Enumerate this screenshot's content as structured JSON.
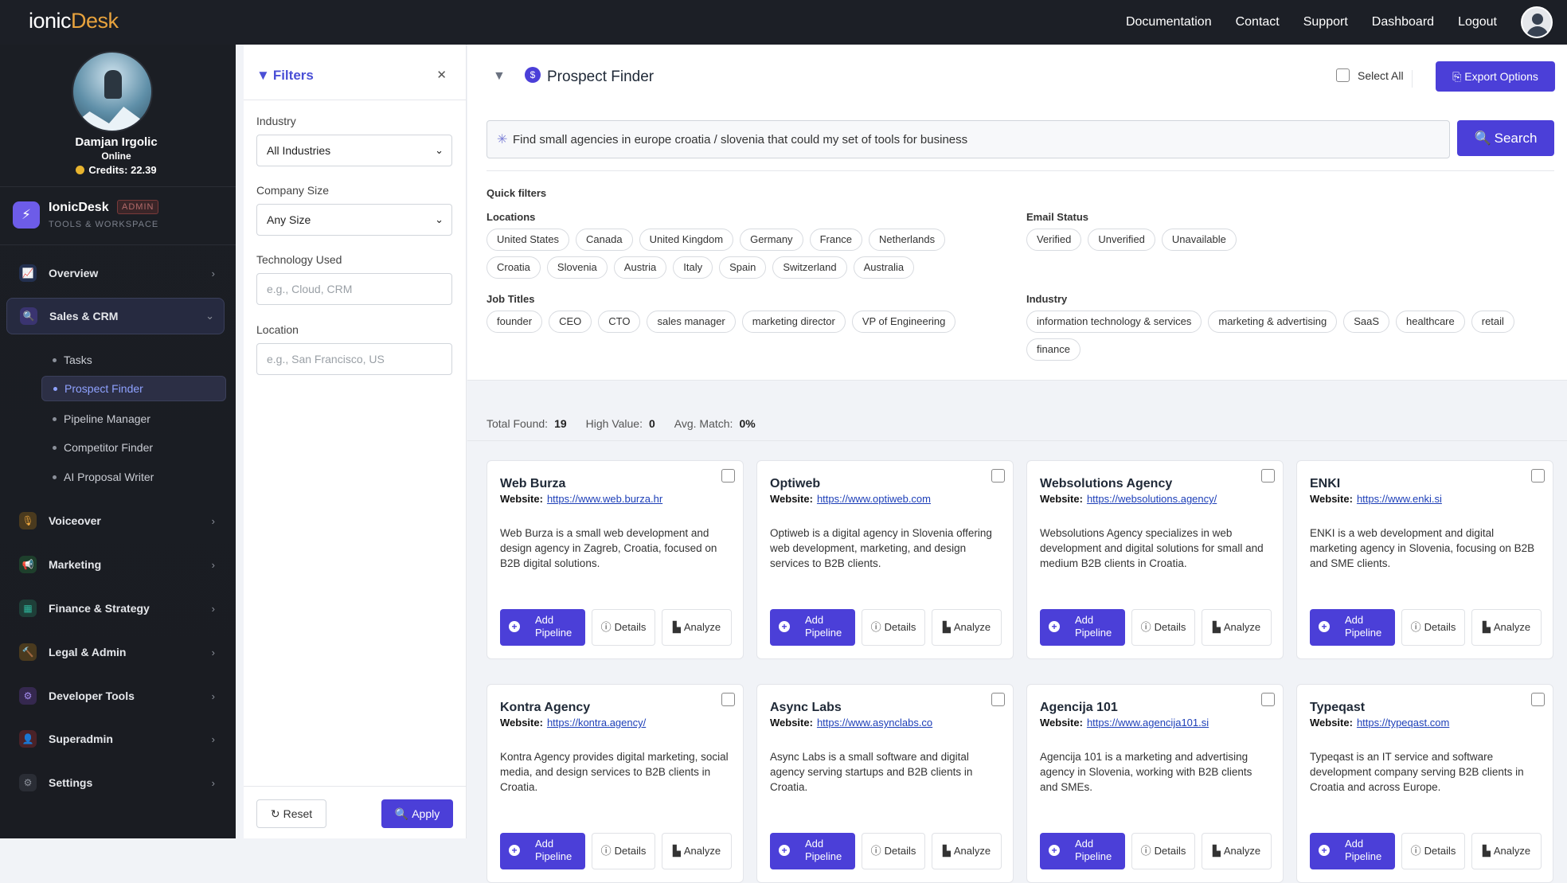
{
  "topbar": {
    "logo_a": "ionic",
    "logo_b": "Desk",
    "nav": [
      "Documentation",
      "Contact",
      "Support",
      "Dashboard",
      "Logout"
    ]
  },
  "profile": {
    "name": "Damjan Irgolic",
    "status": "Online",
    "credits": "Credits: 22.39"
  },
  "brand": {
    "name": "IonicDesk",
    "badge": "ADMIN",
    "subtitle": "TOOLS & WORKSPACE"
  },
  "sidebar": {
    "items": [
      {
        "label": "Overview",
        "icon": "chart-icon",
        "color": "#3b5bdb"
      },
      {
        "label": "Sales & CRM",
        "icon": "search-icon",
        "color": "#6d5ce8"
      },
      {
        "label": "Voiceover",
        "icon": "microphone-icon",
        "color": "#e8a33d"
      },
      {
        "label": "Marketing",
        "icon": "megaphone-icon",
        "color": "#2fb36a"
      },
      {
        "label": "Finance & Strategy",
        "icon": "calculator-icon",
        "color": "#2fb39a"
      },
      {
        "label": "Legal & Admin",
        "icon": "gavel-icon",
        "color": "#e8a33d"
      },
      {
        "label": "Developer Tools",
        "icon": "code-icon",
        "color": "#7b5be8"
      },
      {
        "label": "Superadmin",
        "icon": "user-shield-icon",
        "color": "#e05a6a"
      },
      {
        "label": "Settings",
        "icon": "gear-icon",
        "color": "#8b909a"
      }
    ],
    "sub_items": [
      "Tasks",
      "Prospect Finder",
      "Pipeline Manager",
      "Competitor Finder",
      "AI Proposal Writer"
    ]
  },
  "filters": {
    "title": "Filters",
    "industry_label": "Industry",
    "industry_value": "All Industries",
    "size_label": "Company Size",
    "size_value": "Any Size",
    "tech_label": "Technology Used",
    "tech_placeholder": "e.g., Cloud, CRM",
    "location_label": "Location",
    "location_placeholder": "e.g., San Francisco, US",
    "reset": "Reset",
    "apply": "Apply"
  },
  "header": {
    "title": "Prospect Finder",
    "select_all": "Select All",
    "export": "Export Options"
  },
  "search": {
    "query": "Find small agencies in europe croatia / slovenia that could my set of tools for business",
    "button": "Search"
  },
  "quick_filters": {
    "title": "Quick filters",
    "locations_label": "Locations",
    "locations": [
      "United States",
      "Canada",
      "United Kingdom",
      "Germany",
      "France",
      "Netherlands",
      "Croatia",
      "Slovenia",
      "Austria",
      "Italy",
      "Spain",
      "Switzerland",
      "Australia"
    ],
    "email_label": "Email Status",
    "email": [
      "Verified",
      "Unverified",
      "Unavailable"
    ],
    "jobs_label": "Job Titles",
    "jobs": [
      "founder",
      "CEO",
      "CTO",
      "sales manager",
      "marketing director",
      "VP of Engineering"
    ],
    "industry_label": "Industry",
    "industry": [
      "information technology & services",
      "marketing & advertising",
      "SaaS",
      "healthcare",
      "retail",
      "finance"
    ]
  },
  "stats": {
    "total_label": "Total Found:",
    "total": "19",
    "high_label": "High Value:",
    "high": "0",
    "avg_label": "Avg. Match:",
    "avg": "0%"
  },
  "card_labels": {
    "website": "Website:",
    "add": "Add Pipeline",
    "details": "Details",
    "analyze": "Analyze"
  },
  "results": [
    {
      "name": "Web Burza",
      "url": "https://www.web.burza.hr",
      "desc": "Web Burza is a small web development and design agency in Zagreb, Croatia, focused on B2B digital solutions."
    },
    {
      "name": "Optiweb",
      "url": "https://www.optiweb.com",
      "desc": "Optiweb is a digital agency in Slovenia offering web development, marketing, and design services to B2B clients."
    },
    {
      "name": "Websolutions Agency",
      "url": "https://websolutions.agency/",
      "desc": "Websolutions Agency specializes in web development and digital solutions for small and medium B2B clients in Croatia."
    },
    {
      "name": "ENKI",
      "url": "https://www.enki.si",
      "desc": "ENKI is a web development and digital marketing agency in Slovenia, focusing on B2B and SME clients."
    },
    {
      "name": "Kontra Agency",
      "url": "https://kontra.agency/",
      "desc": "Kontra Agency provides digital marketing, social media, and design services to B2B clients in Croatia."
    },
    {
      "name": "Async Labs",
      "url": "https://www.asynclabs.co",
      "desc": "Async Labs is a small software and digital agency serving startups and B2B clients in Croatia."
    },
    {
      "name": "Agencija 101",
      "url": "https://www.agencija101.si",
      "desc": "Agencija 101 is a marketing and advertising agency in Slovenia, working with B2B clients and SMEs."
    },
    {
      "name": "Typeqast",
      "url": "https://typeqast.com",
      "desc": "Typeqast is an IT service and software development company serving B2B clients in Croatia and across Europe."
    }
  ]
}
